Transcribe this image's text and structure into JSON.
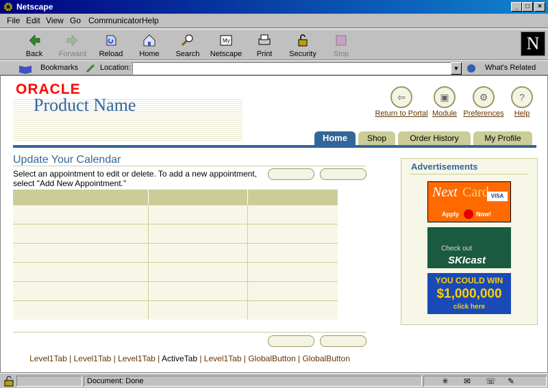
{
  "window": {
    "title": "Netscape"
  },
  "menu": [
    "File",
    "Edit",
    "View",
    "Go",
    "Communicator",
    "Help"
  ],
  "toolbar": [
    {
      "label": "Back",
      "icon": "back-arrow-icon"
    },
    {
      "label": "Forward",
      "icon": "forward-arrow-icon"
    },
    {
      "label": "Reload",
      "icon": "reload-icon"
    },
    {
      "label": "Home",
      "icon": "home-icon"
    },
    {
      "label": "Search",
      "icon": "search-icon"
    },
    {
      "label": "Netscape",
      "icon": "netscape-icon"
    },
    {
      "label": "Print",
      "icon": "print-icon"
    },
    {
      "label": "Security",
      "icon": "lock-icon"
    },
    {
      "label": "Stop",
      "icon": "stop-icon"
    }
  ],
  "location": {
    "bookmarks": "Bookmarks",
    "location_label": "Location:",
    "value": "",
    "whats_related": "What's Related"
  },
  "page": {
    "logo": "ORACLE",
    "product": "Product Name",
    "global_links": [
      {
        "label": "Return to Portal",
        "icon": "portal-icon"
      },
      {
        "label": "Module",
        "icon": "module-icon"
      },
      {
        "label": "Preferences",
        "icon": "preferences-icon"
      },
      {
        "label": "Help",
        "icon": "help-icon"
      }
    ],
    "tabs": [
      "Home",
      "Shop",
      "Order History",
      "My Profile"
    ],
    "heading": "Update Your Calendar",
    "intro": "Select an appointment to edit or delete. To add a new appointment, select \"Add New Appointment.\"",
    "footer": [
      "Level1Tab",
      "Level1Tab",
      "Level1Tab",
      "ActiveTab",
      "Level1Tab",
      "GlobalButton",
      "GlobalButton"
    ],
    "ads_title": "Advertisements",
    "ad1": {
      "a": "Next",
      "b": "Card",
      "c": "VISA",
      "d": "Apply",
      "e": "Now!"
    },
    "ad2": {
      "a": "Check out",
      "b": "SKIcast"
    },
    "ad3": {
      "a": "YOU COULD WIN",
      "b": "$1,000,000",
      "c": "click here"
    }
  },
  "status": {
    "text": "Document: Done"
  }
}
